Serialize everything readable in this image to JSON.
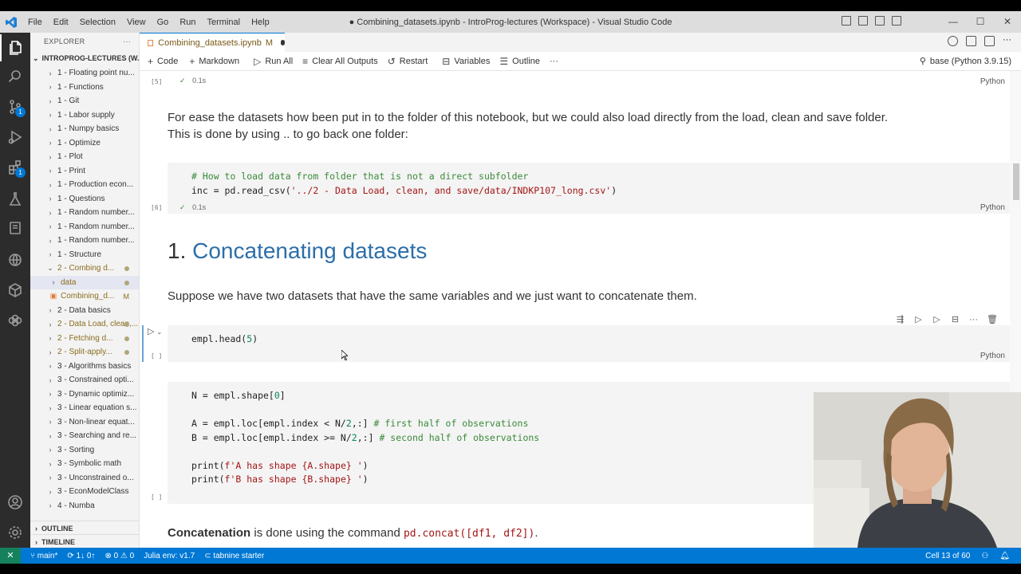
{
  "window": {
    "title": "● Combining_datasets.ipynb - IntroProg-lectures (Workspace) - Visual Studio Code",
    "menu": [
      "File",
      "Edit",
      "Selection",
      "View",
      "Go",
      "Run",
      "Terminal",
      "Help"
    ],
    "controls": {
      "minimize": "—",
      "maximize": "☐",
      "close": "✕"
    }
  },
  "activity_bar": {
    "icons": [
      "explorer-icon",
      "search-icon",
      "source-control-icon",
      "run-debug-icon",
      "extensions-icon",
      "testing-icon",
      "notebook-icon",
      "remote-icon",
      "jupyter-icon",
      "python-icon",
      "account-icon",
      "settings-icon"
    ],
    "badges": {
      "source_control": "1",
      "extensions": "1"
    }
  },
  "sidebar": {
    "title": "EXPLORER",
    "more": "···",
    "root": "INTROPROG-LECTURES (W...",
    "items": [
      {
        "label": "1 - Floating point nu...",
        "chev": "›"
      },
      {
        "label": "1 - Functions",
        "chev": "›"
      },
      {
        "label": "1 - Git",
        "chev": "›"
      },
      {
        "label": "1 - Labor supply",
        "chev": "›"
      },
      {
        "label": "1 - Numpy basics",
        "chev": "›"
      },
      {
        "label": "1 - Optimize",
        "chev": "›"
      },
      {
        "label": "1 - Plot",
        "chev": "›"
      },
      {
        "label": "1 - Print",
        "chev": "›"
      },
      {
        "label": "1 - Production econ...",
        "chev": "›"
      },
      {
        "label": "1 - Questions",
        "chev": "›"
      },
      {
        "label": "1 - Random number...",
        "chev": "›"
      },
      {
        "label": "1 - Random number...",
        "chev": "›"
      },
      {
        "label": "1 - Random number...",
        "chev": "›"
      },
      {
        "label": "1 - Structure",
        "chev": "›"
      },
      {
        "label": "2 - Combing d...",
        "chev": "⌄",
        "dot": true
      },
      {
        "label": "data",
        "chev": "›",
        "dot": true,
        "indent": 1,
        "selected": true
      },
      {
        "label": "Combining_d...",
        "chev": "",
        "mark": "M",
        "indent": 1,
        "file": true
      },
      {
        "label": "2 - Data basics",
        "chev": "›"
      },
      {
        "label": "2 - Data Load, clean,...",
        "chev": "›",
        "dot": true
      },
      {
        "label": "2 - Fetching d...",
        "chev": "›",
        "dot": true
      },
      {
        "label": "2 - Split-apply...",
        "chev": "›",
        "dot": true
      },
      {
        "label": "3 - Algorithms basics",
        "chev": "›"
      },
      {
        "label": "3 - Constrained opti...",
        "chev": "›"
      },
      {
        "label": "3 - Dynamic optimiz...",
        "chev": "›"
      },
      {
        "label": "3 - Linear equation s...",
        "chev": "›"
      },
      {
        "label": "3 - Non-linear equat...",
        "chev": "›"
      },
      {
        "label": "3 - Searching and re...",
        "chev": "›"
      },
      {
        "label": "3 - Sorting",
        "chev": "›"
      },
      {
        "label": "3 - Symbolic math",
        "chev": "›"
      },
      {
        "label": "3 - Unconstrained o...",
        "chev": "›"
      },
      {
        "label": "3 - EconModelClass",
        "chev": "›"
      },
      {
        "label": "4 - Numba",
        "chev": "›"
      }
    ],
    "outline": "OUTLINE",
    "timeline": "TIMELINE"
  },
  "tab": {
    "label": "Combining_datasets.ipynb",
    "mark": "M"
  },
  "toolbar": {
    "code": "Code",
    "markdown": "Markdown",
    "run_all": "Run All",
    "clear_outputs": "Clear All Outputs",
    "restart": "Restart",
    "variables": "Variables",
    "outline": "Outline",
    "more": "···",
    "kernel": "base (Python 3.9.15)"
  },
  "cells": {
    "c5": {
      "exec": "[5]",
      "time": "0.1s",
      "lang": "Python"
    },
    "md1": {
      "line1": "For ease the datasets how been put in to the folder of this notebook, but we could also load directly from the load, clean and save folder.",
      "line2": "This is done by using .. to go back one folder:"
    },
    "c6": {
      "exec": "[6]",
      "time": "0.1s",
      "lang": "Python",
      "comment": "# How to load data from folder that is not a direct subfolder",
      "line2_pre": "inc = pd.read_csv(",
      "line2_str": "'../2 - Data Load, clean, and save/data/INDKP107_long.csv'",
      "line2_post": ")"
    },
    "heading": {
      "number": "1.",
      "text": "Concatenating datasets"
    },
    "md2": "Suppose we have two datasets that have the same variables and we just want to concatenate them.",
    "c7": {
      "exec": "[ ]",
      "lang": "Python",
      "pre": "empl.head(",
      "num": "5",
      "post": ")"
    },
    "c8": {
      "exec": "[ ]",
      "l1_pre": "N = empl.shape[",
      "l1_num": "0",
      "l1_post": "]",
      "l2_pre": "A = empl.loc[empl.index < N/",
      "l2_num": "2",
      "l2_mid": ",:] ",
      "l2_cm": "# first half of observations",
      "l3_pre": "B = empl.loc[empl.index >= N/",
      "l3_num": "2",
      "l3_mid": ",:] ",
      "l3_cm": "# second half of observations",
      "l4_pre": "print(",
      "l4_str": "f'A has shape {A.shape} '",
      "l4_post": ")",
      "l5_pre": "print(",
      "l5_str": "f'B has shape {B.shape} '",
      "l5_post": ")"
    },
    "md3": {
      "bold": "Concatenation",
      "rest": " is done using the command ",
      "code": "pd.concat([df1, df2])",
      "end": "."
    }
  },
  "statusbar": {
    "branch": "main*",
    "sync": "1↓ 0↑",
    "problems": "⊗ 0 ⚠ 0",
    "julia": "Julia env: v1.7",
    "tabnine": "⊂ tabnine starter",
    "cell": "Cell 13 of 60"
  }
}
